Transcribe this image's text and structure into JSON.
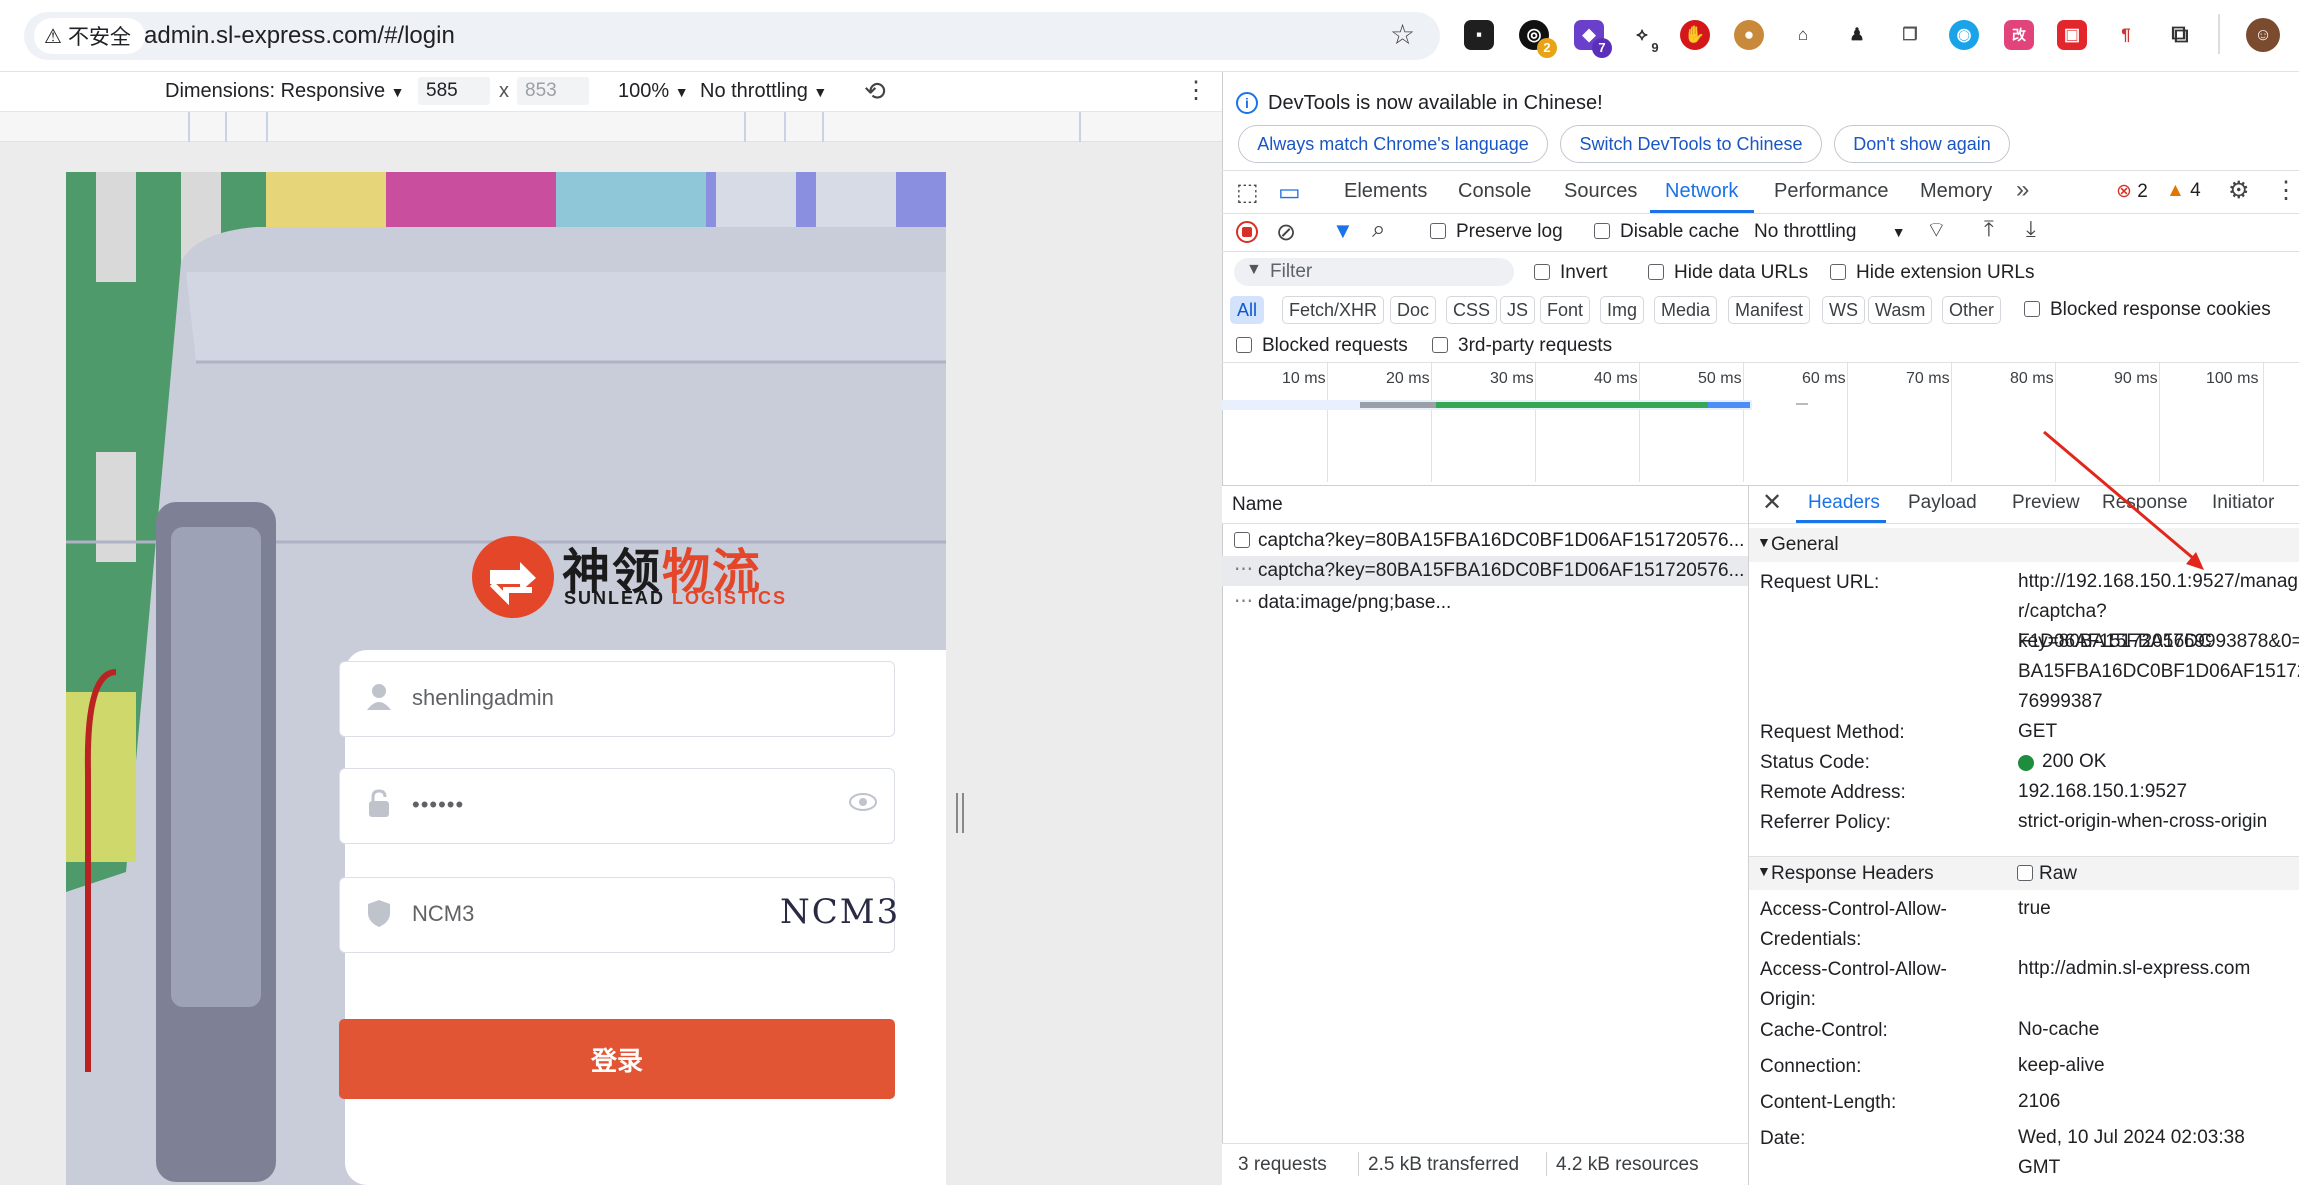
{
  "browser": {
    "security_label": "不安全",
    "url": "admin.sl-express.com/#/login",
    "extension_badges": [
      "2",
      "7",
      "9"
    ],
    "extension_labels": [
      "改"
    ]
  },
  "device_toolbar": {
    "dimensions_label": "Dimensions: Responsive",
    "width": "585",
    "x": "x",
    "height_placeholder": "853",
    "zoom": "100%",
    "throttling": "No throttling"
  },
  "login": {
    "logo_cn_black": "神领",
    "logo_cn_orange": "物流",
    "logo_en_black": "SUNLEAD",
    "logo_en_orange": "LOGISTICS",
    "username": "shenlingadmin",
    "password_mask": "••••••",
    "captcha_value": "NCM3",
    "captcha_image_text": "NCM3",
    "submit_label": "登录"
  },
  "devtools": {
    "notice": "DevTools is now available in Chinese!",
    "notice_buttons": [
      "Always match Chrome's language",
      "Switch DevTools to Chinese",
      "Don't show again"
    ],
    "tabs": [
      "Elements",
      "Console",
      "Sources",
      "Network",
      "Performance",
      "Memory"
    ],
    "active_tab": "Network",
    "errors_count": "2",
    "warnings_count": "4",
    "toolbar": {
      "preserve_log": "Preserve log",
      "disable_cache": "Disable cache",
      "throttling": "No throttling"
    },
    "filter": {
      "placeholder": "Filter",
      "invert": "Invert",
      "hide_data_urls": "Hide data URLs",
      "hide_extension_urls": "Hide extension URLs",
      "types": [
        "All",
        "Fetch/XHR",
        "Doc",
        "CSS",
        "JS",
        "Font",
        "Img",
        "Media",
        "Manifest",
        "WS",
        "Wasm",
        "Other"
      ],
      "blocked_response_cookies": "Blocked response cookies",
      "blocked_requests": "Blocked requests",
      "third_party": "3rd-party requests"
    },
    "timeline_ticks": [
      "10 ms",
      "20 ms",
      "30 ms",
      "40 ms",
      "50 ms",
      "60 ms",
      "70 ms",
      "80 ms",
      "90 ms",
      "100 ms"
    ],
    "requests": {
      "column": "Name",
      "rows": [
        "captcha?key=80BA15FBA16DC0BF1D06AF151720576...",
        "captcha?key=80BA15FBA16DC0BF1D06AF151720576...",
        "data:image/png;base..."
      ]
    },
    "detail_tabs": [
      "Headers",
      "Payload",
      "Preview",
      "Response",
      "Initiator"
    ],
    "general": {
      "title": "General",
      "request_url_label": "Request URL:",
      "request_url_lines": [
        "http://192.168.150.1:9527/manag",
        "r/captcha?key=80BA15FBA16DC",
        "F1D06AF1517205769993878&0=8",
        "BA15FBA16DC0BF1D06AF15172",
        "76999387"
      ],
      "method_label": "Request Method:",
      "method": "GET",
      "status_label": "Status Code:",
      "status": "200 OK",
      "remote_label": "Remote Address:",
      "remote": "192.168.150.1:9527",
      "referrer_label": "Referrer Policy:",
      "referrer": "strict-origin-when-cross-origin"
    },
    "response_headers": {
      "title": "Response Headers",
      "raw": "Raw",
      "acac_label_1": "Access-Control-Allow-",
      "acac_label_2": "Credentials:",
      "acac": "true",
      "acao_label_1": "Access-Control-Allow-",
      "acao_label_2": "Origin:",
      "acao": "http://admin.sl-express.com",
      "cache_label": "Cache-Control:",
      "cache": "No-cache",
      "connection_label": "Connection:",
      "connection": "keep-alive",
      "length_label": "Content-Length:",
      "length": "2106",
      "date_label": "Date:",
      "date_1": "Wed, 10 Jul 2024 02:03:38",
      "date_2": "GMT"
    },
    "status_bar": {
      "requests": "3 requests",
      "transferred": "2.5 kB transferred",
      "resources": "4.2 kB resources"
    }
  }
}
